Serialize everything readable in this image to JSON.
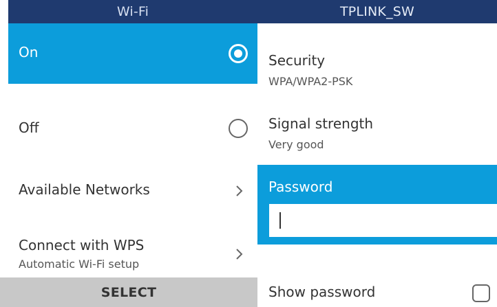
{
  "wifi_pane": {
    "header_title": "Wi-Fi",
    "items": [
      {
        "label": "On",
        "sublabel": "",
        "control": "radio",
        "checked": true,
        "selected": true
      },
      {
        "label": "Off",
        "sublabel": "",
        "control": "radio",
        "checked": false,
        "selected": false
      },
      {
        "label": "Available Networks",
        "sublabel": "",
        "control": "chevron",
        "selected": false
      },
      {
        "label": "Connect with WPS",
        "sublabel": "Automatic Wi-Fi setup",
        "control": "chevron",
        "selected": false
      }
    ]
  },
  "network_pane": {
    "header_title": "TPLINK_SW",
    "security": {
      "label": "Security",
      "value": "WPA/WPA2-PSK"
    },
    "signal": {
      "label": "Signal strength",
      "value": "Very good"
    },
    "password": {
      "label": "Password",
      "value": "",
      "placeholder": ""
    },
    "show_password": {
      "label": "Show password",
      "checked": false
    }
  },
  "softkeys": {
    "center": "SELECT"
  },
  "colors": {
    "header_bg": "#1f3a6f",
    "accent": "#0c9ddb",
    "softkey_bg": "#c8c8c8",
    "text": "#333333"
  },
  "icons": {
    "radio_checked": "radio-checked-icon",
    "radio_unchecked": "radio-unchecked-icon",
    "chevron": "chevron-right-icon",
    "checkbox": "checkbox-unchecked-icon"
  }
}
